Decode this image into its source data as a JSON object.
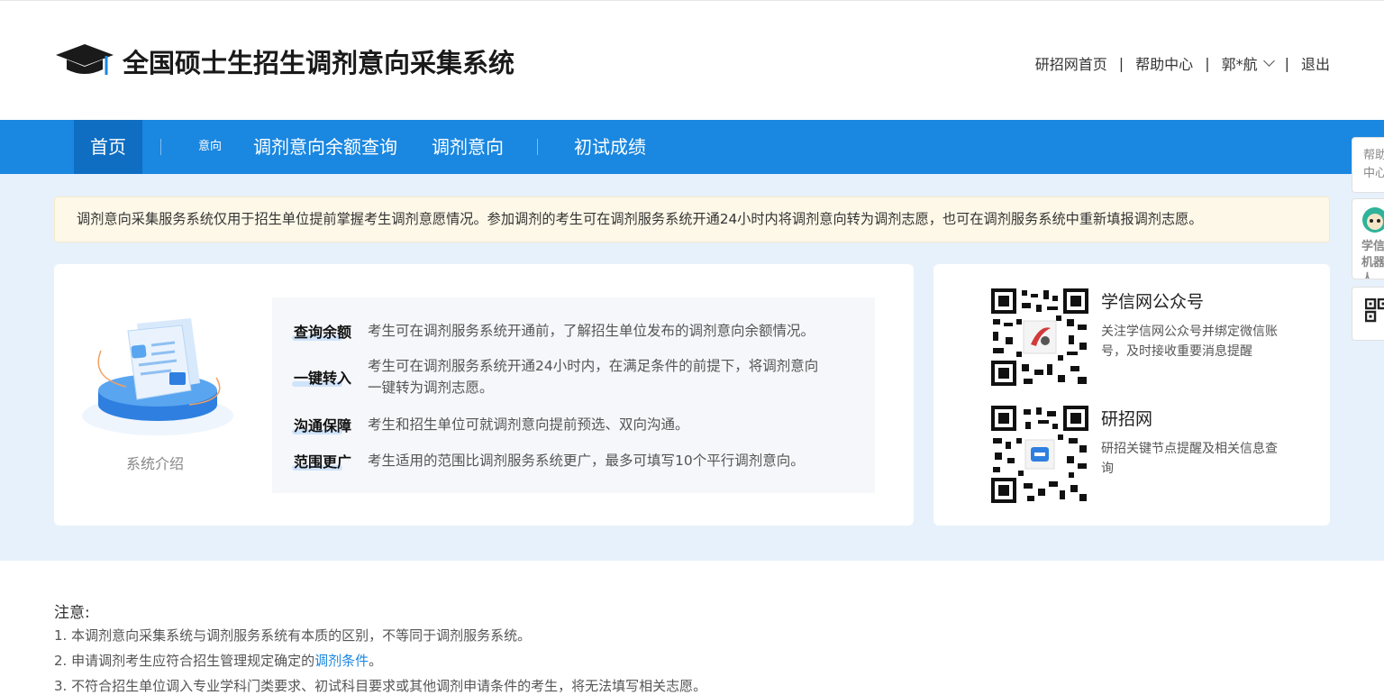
{
  "header": {
    "title": "全国硕士生招生调剂意向采集系统",
    "links": {
      "home": "研招网首页",
      "help": "帮助中心",
      "user": "郭*航",
      "logout": "退出",
      "separator": "|"
    }
  },
  "nav": {
    "home": "首页",
    "small": "意向",
    "quota": "调剂意向余额查询",
    "intent": "调剂意向",
    "score": "初试成绩"
  },
  "notice": "调剂意向采集服务系统仅用于招生单位提前掌握考生调剂意愿情况。参加调剂的考生可在调剂服务系统开通24小时内将调剂意向转为调剂志愿，也可在调剂服务系统中重新填报调剂志愿。",
  "intro": {
    "label": "系统介绍",
    "features": [
      {
        "title": "查询余额",
        "desc": "考生可在调剂服务系统开通前，了解招生单位发布的调剂意向余额情况。"
      },
      {
        "title": "一键转入",
        "desc_line1": "考生可在调剂服务系统开通24小时内，在满足条件的前提下，将调剂意向",
        "desc_line2": "一键转为调剂志愿。"
      },
      {
        "title": "沟通保障",
        "desc": "考生和招生单位可就调剂意向提前预选、双向沟通。"
      },
      {
        "title": "范围更广",
        "desc": "考生适用的范围比调剂服务系统更广，最多可填写10个平行调剂意向。"
      }
    ]
  },
  "qrcodes": [
    {
      "title": "学信网公众号",
      "desc": "关注学信网公众号并绑定微信账号，及时接收重要消息提醒"
    },
    {
      "title": "研招网",
      "desc": "研招关键节点提醒及相关信息查询"
    }
  ],
  "float": {
    "help": "帮助中心",
    "robot": "学信机器人"
  },
  "notes": {
    "title": "注意:",
    "line1": "1. 本调剂意向采集系统与调剂服务系统有本质的区别，不等同于调剂服务系统。",
    "line2_prefix": "2. 申请调剂考生应符合招生管理规定确定的",
    "line2_link": "调剂条件",
    "line2_suffix": "。",
    "line3": "3. 不符合招生单位调入专业学科门类要求、初试科目要求或其他调剂申请条件的考生，将无法填写相关志愿。"
  },
  "colors": {
    "nav": "#1a87e0",
    "nav_active": "#0f6ec2",
    "background": "#e7f1fb",
    "notice_bg": "#fdf8e8",
    "link": "#1a87e0"
  }
}
